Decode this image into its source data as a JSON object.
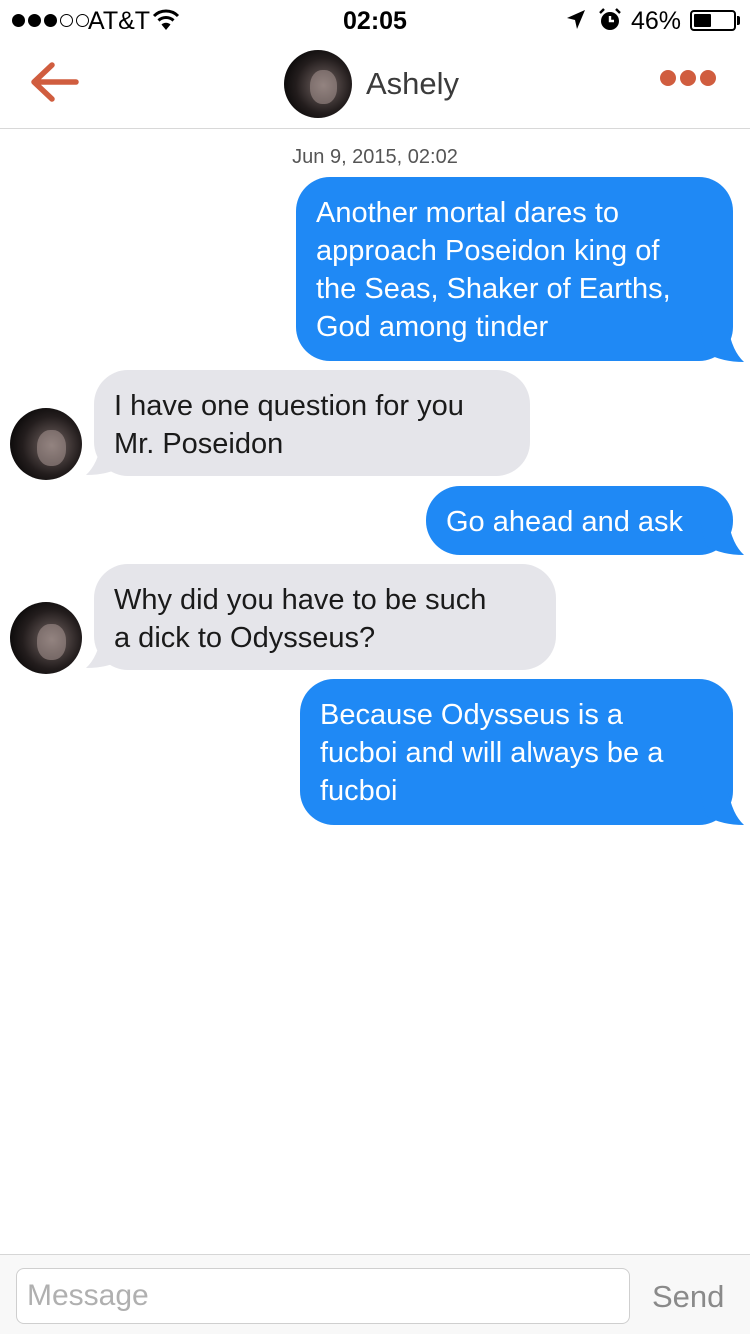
{
  "status_bar": {
    "carrier": "AT&T",
    "time": "02:05",
    "battery_percent": "46%",
    "battery_level": 0.46,
    "signal_bars_filled": 3,
    "signal_bars_total": 5
  },
  "header": {
    "contact_name": "Ashely",
    "accent_color": "#d05d3f"
  },
  "conversation": {
    "timestamp": "Jun 9, 2015, 02:02",
    "messages": [
      {
        "direction": "outgoing",
        "lines": [
          "Another mortal dares to",
          "approach Poseidon king of",
          "the Seas, Shaker of Earths,",
          "God among tinder"
        ]
      },
      {
        "direction": "incoming",
        "lines": [
          "I have one question for you",
          "Mr. Poseidon"
        ]
      },
      {
        "direction": "outgoing",
        "lines": [
          "Go ahead and ask"
        ]
      },
      {
        "direction": "incoming",
        "lines": [
          "Why did you have to be such",
          "a dick to Odysseus?"
        ]
      },
      {
        "direction": "outgoing",
        "lines": [
          "Because Odysseus is a",
          "fucboi and will always be a",
          "fucboi"
        ]
      }
    ]
  },
  "composer": {
    "placeholder": "Message",
    "send_label": "Send"
  },
  "colors": {
    "outgoing_bubble": "#1f89f5",
    "incoming_bubble": "#e5e5ea"
  }
}
